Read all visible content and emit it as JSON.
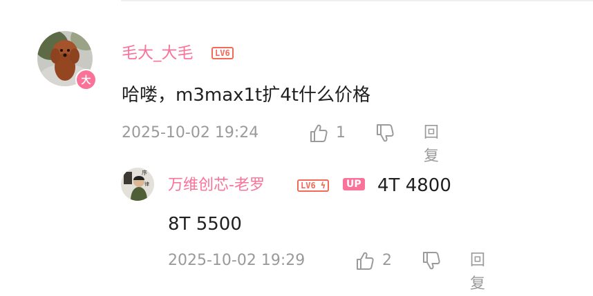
{
  "main_comment": {
    "username": "毛大_大毛",
    "level": "LV6",
    "avatar_badge": "大",
    "content": "哈喽，m3max1t扩4t什么价格",
    "timestamp": "2025-10-02 19:24",
    "like_count": "1",
    "reply_label": "回复"
  },
  "reply_comment": {
    "username": "万维创芯-老罗",
    "level": "LV6",
    "up_badge": "UP",
    "content_line1": "4T 4800",
    "content_line2": "8T 5500",
    "timestamp": "2025-10-02 19:29",
    "like_count": "2",
    "reply_label": "回复"
  },
  "colors": {
    "username": "#fb7299",
    "level": "#f26a55",
    "meta": "#9a9a9a"
  },
  "icons": [
    "thumb-up-icon",
    "thumb-down-icon"
  ]
}
